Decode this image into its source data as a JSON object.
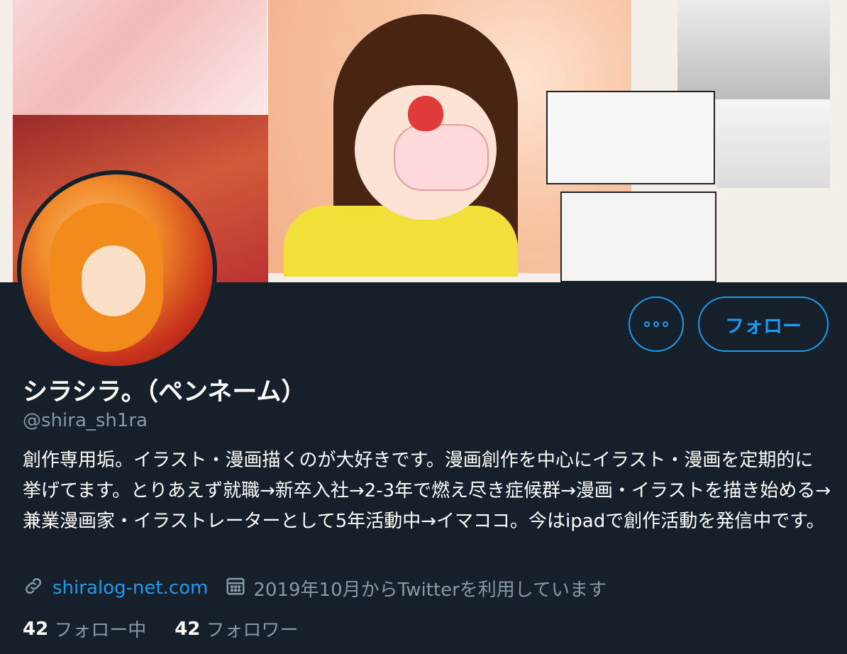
{
  "profile": {
    "display_name": "シラシラ。（ペンネーム）",
    "handle": "@shira_sh1ra",
    "bio": "創作専用垢。イラスト・漫画描くのが大好きです。漫画創作を中心にイラスト・漫画を定期的に挙げてます。とりあえず就職→新卒入社→2-3年で燃え尽き症候群→漫画・イラストを描き始める→兼業漫画家・イラストレーターとして5年活動中→イマココ。今はipadで創作活動を発信中です。",
    "website": "shiralog-net.com",
    "joined": "2019年10月からTwitterを利用しています"
  },
  "buttons": {
    "follow_label": "フォロー",
    "more_icon": "more-dots-icon"
  },
  "stats": {
    "following_count": "42",
    "following_label": "フォロー中",
    "followers_count": "42",
    "followers_label": "フォロワー"
  },
  "icons": {
    "link": "link-icon",
    "calendar": "calendar-icon"
  },
  "colors": {
    "background": "#15202b",
    "accent": "#1d9bf0",
    "secondary_text": "#8899a6",
    "primary_text": "#ffffff"
  }
}
